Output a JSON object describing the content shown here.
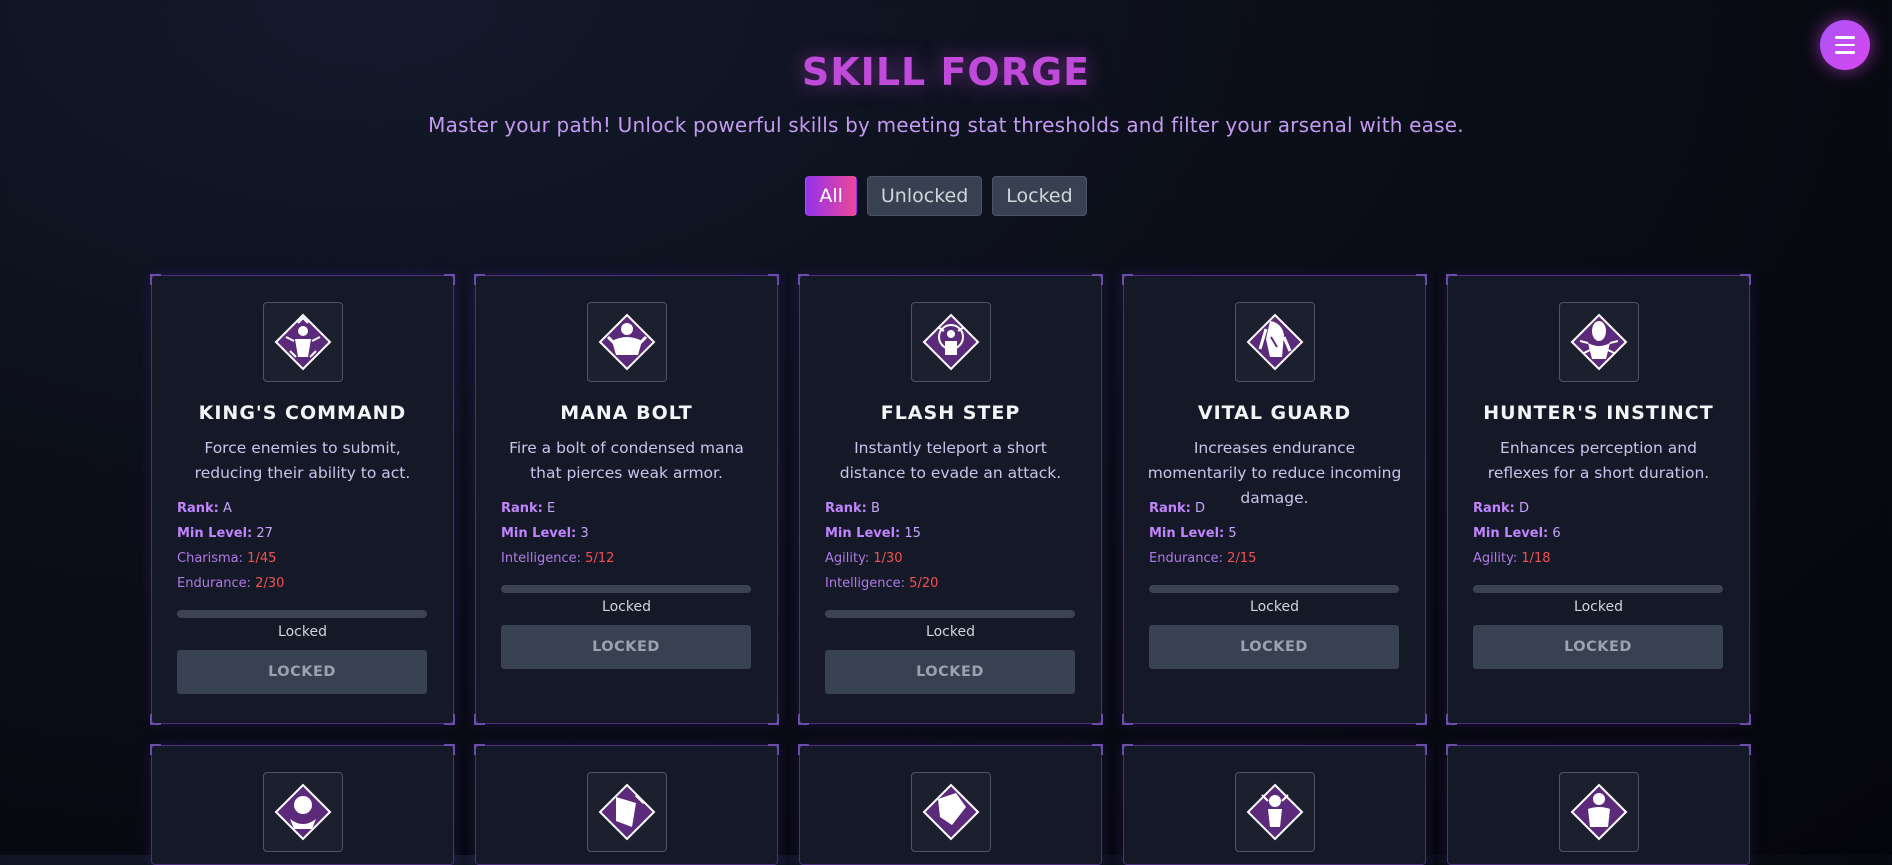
{
  "header": {
    "title": "SKILL FORGE",
    "subtitle": "Master your path! Unlock powerful skills by meeting stat thresholds and filter your arsenal with ease."
  },
  "filters": [
    {
      "label": "All",
      "active": true
    },
    {
      "label": "Unlocked",
      "active": false
    },
    {
      "label": "Locked",
      "active": false
    }
  ],
  "labels": {
    "rank": "Rank:",
    "min_level": "Min Level:"
  },
  "colors": {
    "accent": "#c04ad9",
    "locked_value": "#f05252",
    "card_border": "#4c2f7d"
  },
  "skills": [
    {
      "name": "KING'S COMMAND",
      "description": "Force enemies to submit, reducing their ability to act.",
      "rank": "A",
      "min_level": "27",
      "requirements": [
        {
          "stat": "Charisma:",
          "value": "1/45"
        },
        {
          "stat": "Endurance:",
          "value": "2/30"
        }
      ],
      "progress": 0,
      "status": "Locked",
      "button": "LOCKED",
      "icon": "king-command-icon"
    },
    {
      "name": "MANA BOLT",
      "description": "Fire a bolt of condensed mana that pierces weak armor.",
      "rank": "E",
      "min_level": "3",
      "requirements": [
        {
          "stat": "Intelligence:",
          "value": "5/12"
        }
      ],
      "progress": 0,
      "status": "Locked",
      "button": "LOCKED",
      "icon": "mana-bolt-icon"
    },
    {
      "name": "FLASH STEP",
      "description": "Instantly teleport a short distance to evade an attack.",
      "rank": "B",
      "min_level": "15",
      "requirements": [
        {
          "stat": "Agility:",
          "value": "1/30"
        },
        {
          "stat": "Intelligence:",
          "value": "5/20"
        }
      ],
      "progress": 0,
      "status": "Locked",
      "button": "LOCKED",
      "icon": "flash-step-icon"
    },
    {
      "name": "VITAL GUARD",
      "description": "Increases endurance momentarily to reduce incoming damage.",
      "rank": "D",
      "min_level": "5",
      "requirements": [
        {
          "stat": "Endurance:",
          "value": "2/15"
        }
      ],
      "progress": 0,
      "status": "Locked",
      "button": "LOCKED",
      "icon": "vital-guard-icon"
    },
    {
      "name": "HUNTER'S INSTINCT",
      "description": "Enhances perception and reflexes for a short duration.",
      "rank": "D",
      "min_level": "6",
      "requirements": [
        {
          "stat": "Agility:",
          "value": "1/18"
        }
      ],
      "progress": 0,
      "status": "Locked",
      "button": "LOCKED",
      "icon": "hunter-instinct-icon"
    }
  ],
  "second_row_icons": [
    "skill-icon-6",
    "skill-icon-7",
    "skill-icon-8",
    "skill-icon-9",
    "skill-icon-10"
  ]
}
